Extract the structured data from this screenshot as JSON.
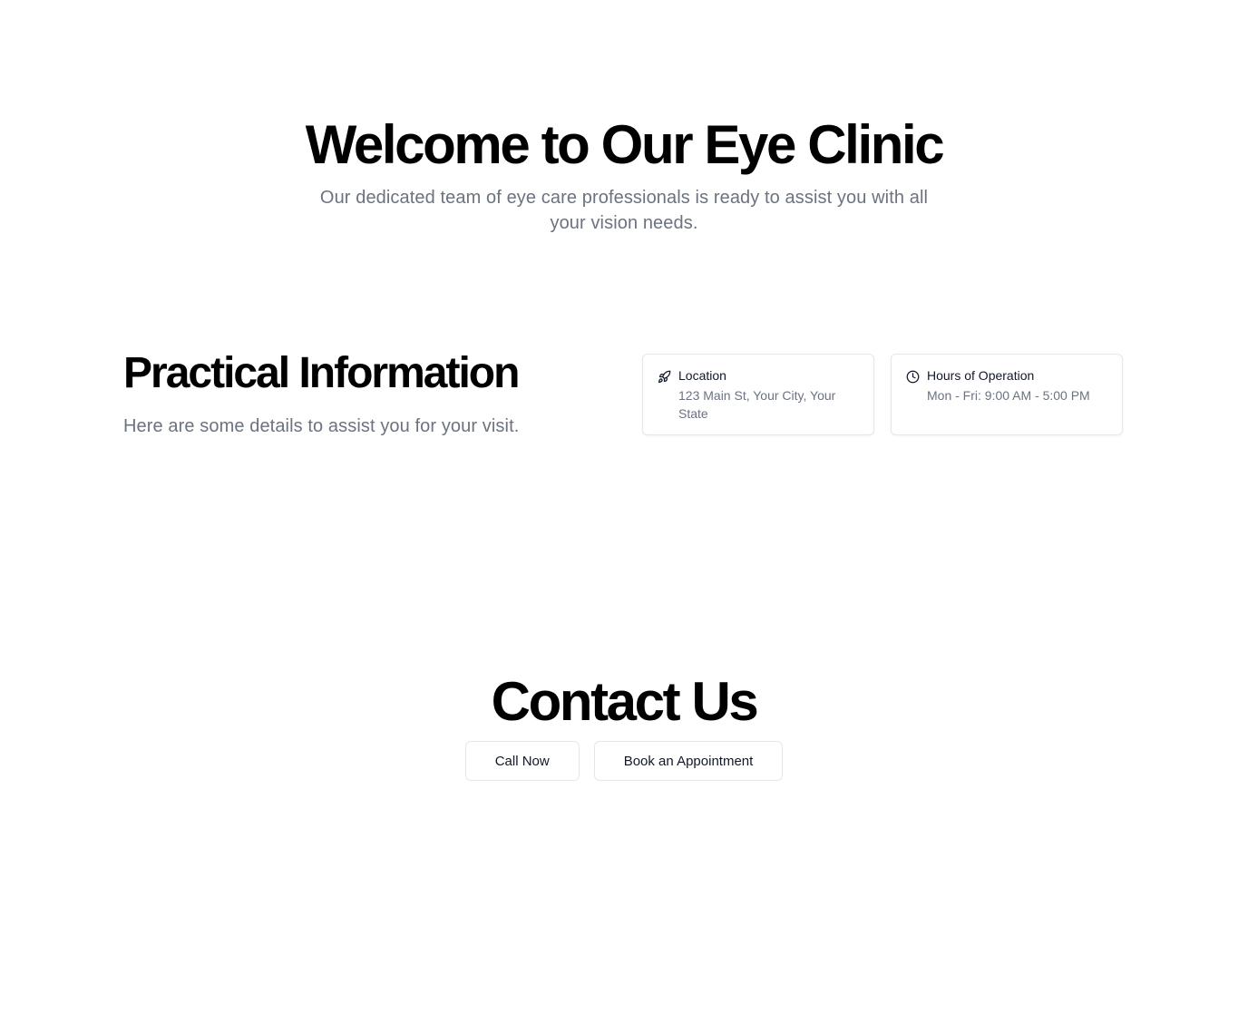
{
  "hero": {
    "title": "Welcome to Our Eye Clinic",
    "subtitle": "Our dedicated team of eye care professionals is ready to assist you with all your vision needs."
  },
  "practical_info": {
    "title": "Practical Information",
    "subtitle": "Here are some details to assist you for your visit.",
    "cards": [
      {
        "icon": "navigation-icon",
        "heading": "Location",
        "detail": "123 Main St, Your City, Your State"
      },
      {
        "icon": "clock-icon",
        "heading": "Hours of Operation",
        "detail": "Mon - Fri: 9:00 AM - 5:00 PM"
      }
    ]
  },
  "contact": {
    "title": "Contact Us",
    "call_label": "Call Now",
    "book_label": "Book an Appointment"
  },
  "colors": {
    "heading": "#000000",
    "muted_text": "#6b7280",
    "border": "#e5e7eb",
    "background": "#ffffff"
  }
}
